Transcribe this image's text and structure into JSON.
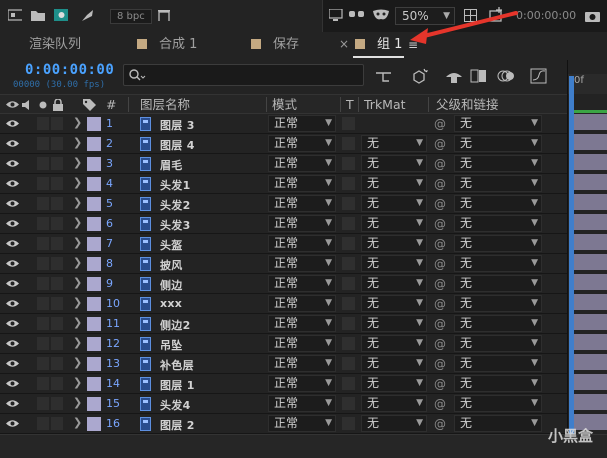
{
  "toolbar": {
    "bpc": "8 bpc"
  },
  "viewer": {
    "zoom": "50%",
    "timecode": "0:00:00:00"
  },
  "tabs": [
    {
      "label": "渲染队列",
      "active": false
    },
    {
      "label": "合成 1",
      "active": false
    },
    {
      "label": "保存",
      "active": false
    },
    {
      "label": "组 1",
      "active": true,
      "close": "×",
      "menu": "≡"
    }
  ],
  "timecode": {
    "value": "0:00:00:00",
    "frames": "00000 (30.00 fps)"
  },
  "columns": {
    "num": "#",
    "layer_name": "图层名称",
    "mode": "模式",
    "t": "T",
    "trkmat": "TrkMat",
    "parent": "父级和链接"
  },
  "ruler_label": "0f",
  "layers": [
    {
      "num": "1",
      "name": "图层 3",
      "mode": "正常",
      "trkmat": "",
      "parent": "无"
    },
    {
      "num": "2",
      "name": "图层 4",
      "mode": "正常",
      "trkmat": "无",
      "parent": "无"
    },
    {
      "num": "3",
      "name": "眉毛",
      "mode": "正常",
      "trkmat": "无",
      "parent": "无"
    },
    {
      "num": "4",
      "name": "头发1",
      "mode": "正常",
      "trkmat": "无",
      "parent": "无"
    },
    {
      "num": "5",
      "name": "头发2",
      "mode": "正常",
      "trkmat": "无",
      "parent": "无"
    },
    {
      "num": "6",
      "name": "头发3",
      "mode": "正常",
      "trkmat": "无",
      "parent": "无"
    },
    {
      "num": "7",
      "name": "头盔",
      "mode": "正常",
      "trkmat": "无",
      "parent": "无"
    },
    {
      "num": "8",
      "name": "披风",
      "mode": "正常",
      "trkmat": "无",
      "parent": "无"
    },
    {
      "num": "9",
      "name": "侧边",
      "mode": "正常",
      "trkmat": "无",
      "parent": "无"
    },
    {
      "num": "10",
      "name": "xxx",
      "mode": "正常",
      "trkmat": "无",
      "parent": "无"
    },
    {
      "num": "11",
      "name": "侧边2",
      "mode": "正常",
      "trkmat": "无",
      "parent": "无"
    },
    {
      "num": "12",
      "name": "吊坠",
      "mode": "正常",
      "trkmat": "无",
      "parent": "无"
    },
    {
      "num": "13",
      "name": "补色层",
      "mode": "正常",
      "trkmat": "无",
      "parent": "无"
    },
    {
      "num": "14",
      "name": "图层 1",
      "mode": "正常",
      "trkmat": "无",
      "parent": "无"
    },
    {
      "num": "15",
      "name": "头发4",
      "mode": "正常",
      "trkmat": "无",
      "parent": "无"
    },
    {
      "num": "16",
      "name": "图层 2",
      "mode": "正常",
      "trkmat": "无",
      "parent": "无"
    }
  ],
  "watermark": "小黑盒",
  "colors": {
    "accent_blue": "#4aa2ff",
    "layer_label": "#aba8cf",
    "tab_label": "#c4a982",
    "annotation_arrow": "#e5352b"
  }
}
